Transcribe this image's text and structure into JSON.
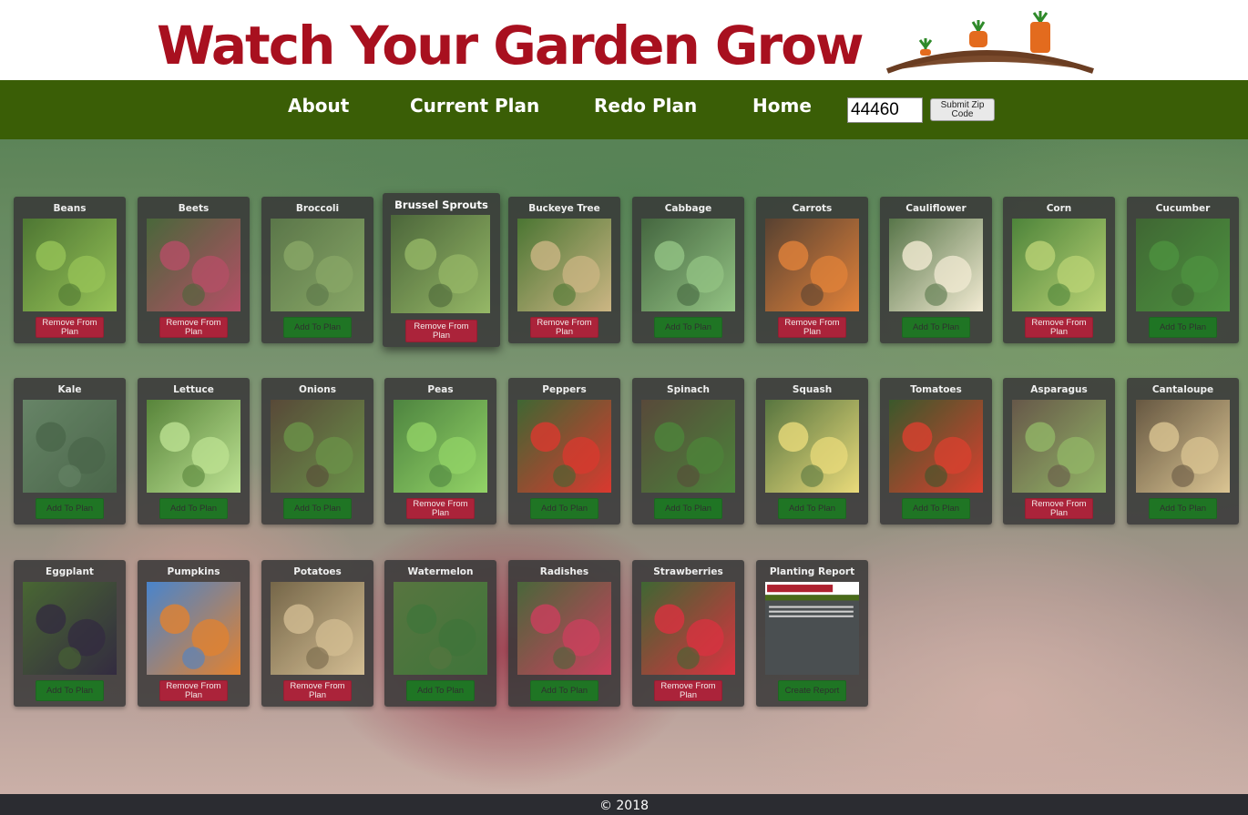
{
  "header": {
    "title": "Watch Your Garden Grow"
  },
  "nav": {
    "about": "About",
    "current_plan": "Current Plan",
    "redo_plan": "Redo Plan",
    "home": "Home",
    "zip_value": "44460",
    "zip_button": "Submit Zip Code"
  },
  "colors": {
    "brand_red": "#a8101f",
    "nav_green": "#3a5e06",
    "add_button": "#0c6a12",
    "remove_button": "#a4112a"
  },
  "plants": [
    {
      "name": "Beans",
      "button": "Remove From Plan",
      "state": "remove",
      "icon": "beans-photo"
    },
    {
      "name": "Beets",
      "button": "Remove From Plan",
      "state": "remove",
      "icon": "beets-photo"
    },
    {
      "name": "Broccoli",
      "button": "Add To Plan",
      "state": "add",
      "icon": "broccoli-photo"
    },
    {
      "name": "Brussel Sprouts",
      "button": "Remove From Plan",
      "state": "remove",
      "icon": "brussel-sprouts-photo",
      "featured": true
    },
    {
      "name": "Buckeye Tree",
      "button": "Remove From Plan",
      "state": "remove",
      "icon": "buckeye-tree-photo"
    },
    {
      "name": "Cabbage",
      "button": "Add To Plan",
      "state": "add",
      "icon": "cabbage-photo"
    },
    {
      "name": "Carrots",
      "button": "Remove From Plan",
      "state": "remove",
      "icon": "carrots-photo"
    },
    {
      "name": "Cauliflower",
      "button": "Add To Plan",
      "state": "add",
      "icon": "cauliflower-photo"
    },
    {
      "name": "Corn",
      "button": "Remove From Plan",
      "state": "remove",
      "icon": "corn-photo"
    },
    {
      "name": "Cucumber",
      "button": "Add To Plan",
      "state": "add",
      "icon": "cucumber-photo"
    },
    {
      "name": "Kale",
      "button": "Add To Plan",
      "state": "add",
      "icon": "kale-photo"
    },
    {
      "name": "Lettuce",
      "button": "Add To Plan",
      "state": "add",
      "icon": "lettuce-photo"
    },
    {
      "name": "Onions",
      "button": "Add To Plan",
      "state": "add",
      "icon": "onions-photo"
    },
    {
      "name": "Peas",
      "button": "Remove From Plan",
      "state": "remove",
      "icon": "peas-photo"
    },
    {
      "name": "Peppers",
      "button": "Add To Plan",
      "state": "add",
      "icon": "peppers-photo"
    },
    {
      "name": "Spinach",
      "button": "Add To Plan",
      "state": "add",
      "icon": "spinach-photo"
    },
    {
      "name": "Squash",
      "button": "Add To Plan",
      "state": "add",
      "icon": "squash-photo"
    },
    {
      "name": "Tomatoes",
      "button": "Add To Plan",
      "state": "add",
      "icon": "tomatoes-photo"
    },
    {
      "name": "Asparagus",
      "button": "Remove From Plan",
      "state": "remove",
      "icon": "asparagus-photo"
    },
    {
      "name": "Cantaloupe",
      "button": "Add To Plan",
      "state": "add",
      "icon": "cantaloupe-photo"
    },
    {
      "name": "Eggplant",
      "button": "Add To Plan",
      "state": "add",
      "icon": "eggplant-photo"
    },
    {
      "name": "Pumpkins",
      "button": "Remove From Plan",
      "state": "remove",
      "icon": "pumpkins-photo"
    },
    {
      "name": "Potatoes",
      "button": "Remove From Plan",
      "state": "remove",
      "icon": "potatoes-photo"
    },
    {
      "name": "Watermelon",
      "button": "Add To Plan",
      "state": "add",
      "icon": "watermelon-photo"
    },
    {
      "name": "Radishes",
      "button": "Add To Plan",
      "state": "add",
      "icon": "radishes-photo"
    },
    {
      "name": "Strawberries",
      "button": "Remove From Plan",
      "state": "remove",
      "icon": "strawberries-photo"
    },
    {
      "name": "Planting Report",
      "button": "Create Report",
      "state": "add",
      "icon": "planting-report-thumbnail"
    }
  ],
  "footer": {
    "copyright": "© 2018"
  }
}
